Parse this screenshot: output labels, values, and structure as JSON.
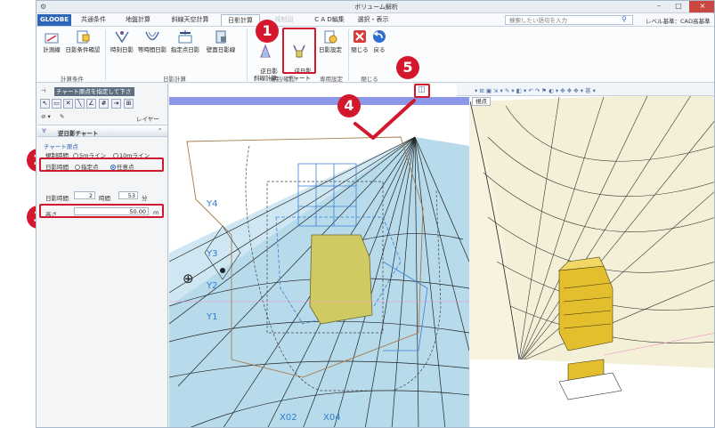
{
  "window": {
    "title": "ボリューム解析",
    "minimize": "–",
    "maximize": "□",
    "close": "×"
  },
  "menu": {
    "tabs": [
      "GLOOBE",
      "共通条件",
      "地盤計算",
      "斜線天空計算",
      "日影計算",
      "規制図",
      "C A D編集",
      "選択・表示"
    ],
    "search_placeholder": "検索したい語句を入力",
    "level_base": "レベル基準：CAD高基準"
  },
  "ribbon": {
    "buttons": {
      "calc_line": "計測線",
      "shadow_cond": "日影条件確認",
      "time_shadow": "時刻日影",
      "equal_time": "等時間日影",
      "point_shadow": "指定点日影",
      "wall_shadow": "壁面日影線",
      "reverse_slant": "逆日影\n斜線計算",
      "reverse_chart": "逆日影\nチャート",
      "shadow_setting": "日影設定",
      "close": "閉じる",
      "back": "戻る"
    },
    "groups": [
      "計算条件",
      "日影計算",
      "規制/確認",
      "専用設定",
      "閉じる"
    ]
  },
  "left_panel": {
    "prompt": "チャート原点を指定して下さい。",
    "layer": "レイヤー",
    "command_title": "逆日影チャート",
    "section_origin": "チャート原点",
    "reg_time_label": "規制時間",
    "reg_opt1": "5mライン",
    "reg_opt2": "10mライン",
    "shadow_time_label": "日影時間",
    "shadow_opt1": "指定点",
    "shadow_opt2": "任意点",
    "shadow_hours_label": "日影時間",
    "hours_value": "2",
    "hours_unit": "時間",
    "minutes_value": "53",
    "minutes_unit": "分",
    "height_label": "高さ",
    "height_value": "50.00",
    "height_unit": "m"
  },
  "view": {
    "tab_label": "視点",
    "ylabels": [
      "Y4",
      "Y3",
      "Y2",
      "Y1"
    ],
    "xlabels": [
      "X02",
      "X04"
    ]
  },
  "markers": [
    "1",
    "2",
    "3",
    "4",
    "5"
  ],
  "colors": {
    "marker": "#d3182e",
    "accent": "#2d66b8",
    "building": "#cfc65e",
    "chart_fill": "#bfe1ef",
    "surface": "#f4f0d8"
  }
}
